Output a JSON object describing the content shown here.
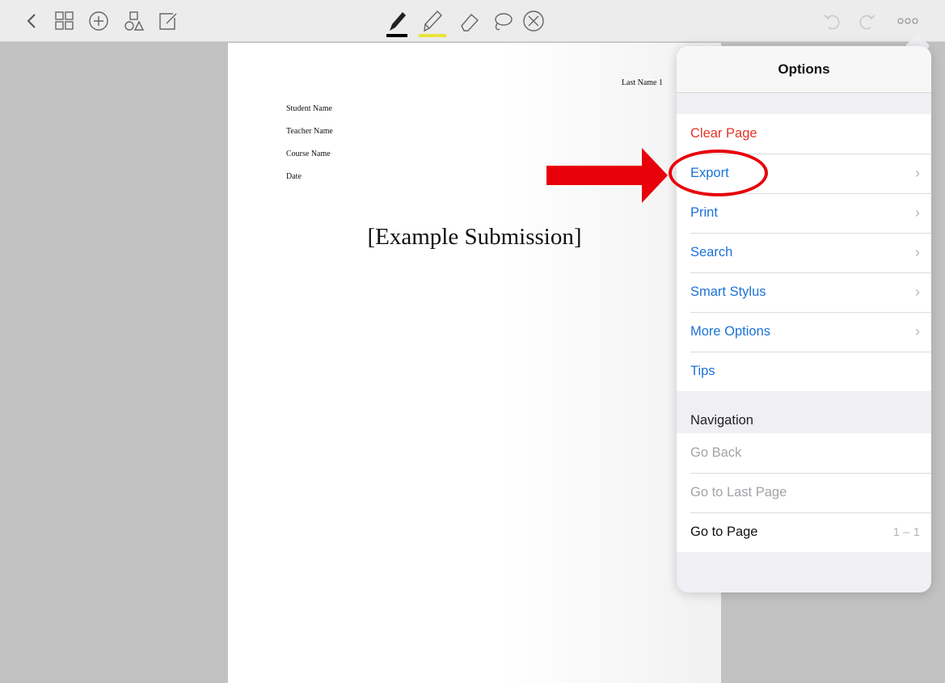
{
  "toolbar": {
    "left_icons": [
      "back-chevron-icon",
      "page-grid-icon",
      "add-circle-icon",
      "shapes-icon",
      "edit-note-icon"
    ],
    "tools": [
      {
        "name": "pen-tool-icon",
        "underline_color": "#000000"
      },
      {
        "name": "highlighter-tool-icon",
        "underline_color": "#e9e43a"
      },
      {
        "name": "eraser-tool-icon"
      },
      {
        "name": "lasso-tool-icon"
      },
      {
        "name": "close-tool-icon"
      }
    ],
    "right_icons": [
      "undo-icon",
      "redo-icon",
      "more-options-icon"
    ]
  },
  "document": {
    "running_head": "Last Name 1",
    "header_lines": [
      "Student Name",
      "Teacher Name",
      "Course Name",
      "Date"
    ],
    "title": "[Example Submission]"
  },
  "options": {
    "title": "Options",
    "actions": [
      {
        "label": "Clear Page",
        "color": "#e3342a"
      },
      {
        "label": "Export",
        "color": "#1b72d6",
        "chevron": true
      },
      {
        "label": "Print",
        "color": "#1b72d6",
        "chevron": true
      },
      {
        "label": "Search",
        "color": "#1b72d6",
        "chevron": true
      },
      {
        "label": "Smart Stylus",
        "color": "#1b72d6",
        "chevron": true
      },
      {
        "label": "More Options",
        "color": "#1b72d6",
        "chevron": true
      },
      {
        "label": "Tips",
        "color": "#1b72d6"
      }
    ],
    "navigation_title": "Navigation",
    "navigation": [
      {
        "label": "Go Back",
        "enabled": false
      },
      {
        "label": "Go to Last Page",
        "enabled": false
      },
      {
        "label": "Go to Page",
        "enabled": true,
        "detail": "1 – 1"
      }
    ]
  },
  "annotation": {
    "arrow_color": "#e8000b",
    "highlight_target": "Export"
  }
}
